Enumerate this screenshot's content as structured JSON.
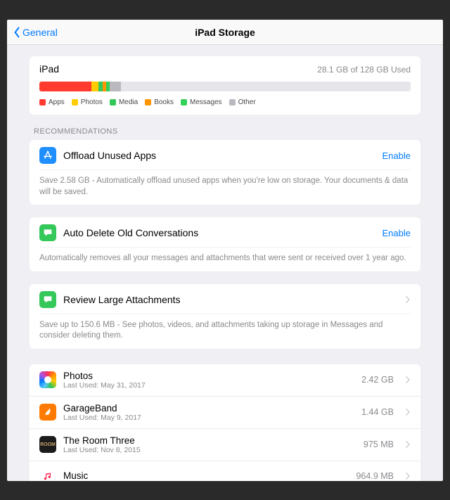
{
  "nav": {
    "back": "General",
    "title": "iPad Storage"
  },
  "storage": {
    "device": "iPad",
    "usage": "28.1 GB of 128 GB Used",
    "segments": [
      {
        "name": "Apps",
        "color": "#ff3b30",
        "pct": 14
      },
      {
        "name": "Photos",
        "color": "#ffcc00",
        "pct": 2
      },
      {
        "name": "Media",
        "color": "#34c759",
        "pct": 1
      },
      {
        "name": "Books",
        "color": "#ff9500",
        "pct": 1
      },
      {
        "name": "Messages",
        "color": "#30d158",
        "pct": 1
      },
      {
        "name": "Other",
        "color": "#b9b9bf",
        "pct": 3
      }
    ]
  },
  "section_label": "RECOMMENDATIONS",
  "recs": [
    {
      "icon": "appstore",
      "icon_color": "#1f8fff",
      "title": "Offload Unused Apps",
      "action": "Enable",
      "body": "Save 2.58 GB - Automatically offload unused apps when you're low on storage. Your documents & data will be saved."
    },
    {
      "icon": "messages",
      "icon_color": "#34c759",
      "title": "Auto Delete Old Conversations",
      "action": "Enable",
      "body": "Automatically removes all your messages and attachments that were sent or received over 1 year ago."
    },
    {
      "icon": "messages",
      "icon_color": "#34c759",
      "title": "Review Large Attachments",
      "action": "chevron",
      "body": "Save up to 150.6 MB - See photos, videos, and attachments taking up storage in Messages and consider deleting them."
    }
  ],
  "apps": [
    {
      "name": "Photos",
      "sub": "Last Used: May 31, 2017",
      "size": "2.42 GB",
      "icon_color": "#ffffff",
      "glyph": "photos"
    },
    {
      "name": "GarageBand",
      "sub": "Last Used: May 9, 2017",
      "size": "1.44 GB",
      "icon_color": "#ff7a00",
      "glyph": "garageband"
    },
    {
      "name": "The Room Three",
      "sub": "Last Used: Nov 8, 2015",
      "size": "975 MB",
      "icon_color": "#1b1b1b",
      "glyph": "room"
    },
    {
      "name": "Music",
      "sub": "",
      "size": "964.9 MB",
      "icon_color": "#ffffff",
      "glyph": "music"
    }
  ]
}
